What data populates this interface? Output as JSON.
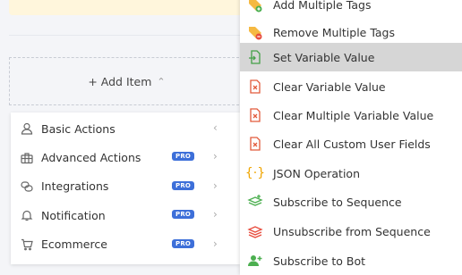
{
  "add_item": {
    "label": "+ Add Item",
    "chevron_icon": "chevron-up-icon"
  },
  "left_menu": [
    {
      "label": "Basic Actions",
      "icon": "user-icon",
      "pro": ""
    },
    {
      "label": "Advanced Actions",
      "icon": "briefcase-icon",
      "pro": "PRO"
    },
    {
      "label": "Integrations",
      "icon": "link-icon",
      "pro": "PRO"
    },
    {
      "label": "Notification",
      "icon": "bell-icon",
      "pro": "PRO"
    },
    {
      "label": "Ecommerce",
      "icon": "cart-icon",
      "pro": "PRO"
    }
  ],
  "right_menu": [
    {
      "label": "Add Multiple Tags",
      "icon": "tag-add-icon"
    },
    {
      "label": "Remove Multiple Tags",
      "icon": "tag-remove-icon"
    },
    {
      "label": "Set Variable Value",
      "icon": "set-variable-icon",
      "selected": true
    },
    {
      "label": "Clear Variable Value",
      "icon": "clear-variable-icon"
    },
    {
      "label": "Clear Multiple Variable Value",
      "icon": "clear-multiple-variable-icon"
    },
    {
      "label": "Clear All Custom User Fields",
      "icon": "clear-user-fields-icon"
    },
    {
      "label": "JSON Operation",
      "icon": "json-braces-icon"
    },
    {
      "label": "Subscribe to Sequence",
      "icon": "subscribe-sequence-icon"
    },
    {
      "label": "Unsubscribe from Sequence",
      "icon": "unsubscribe-sequence-icon"
    },
    {
      "label": "Subscribe to Bot",
      "icon": "subscribe-bot-icon"
    }
  ],
  "colors": {
    "accent_blue": "#3d6fd9",
    "selected_bg": "#d6d6d6"
  }
}
